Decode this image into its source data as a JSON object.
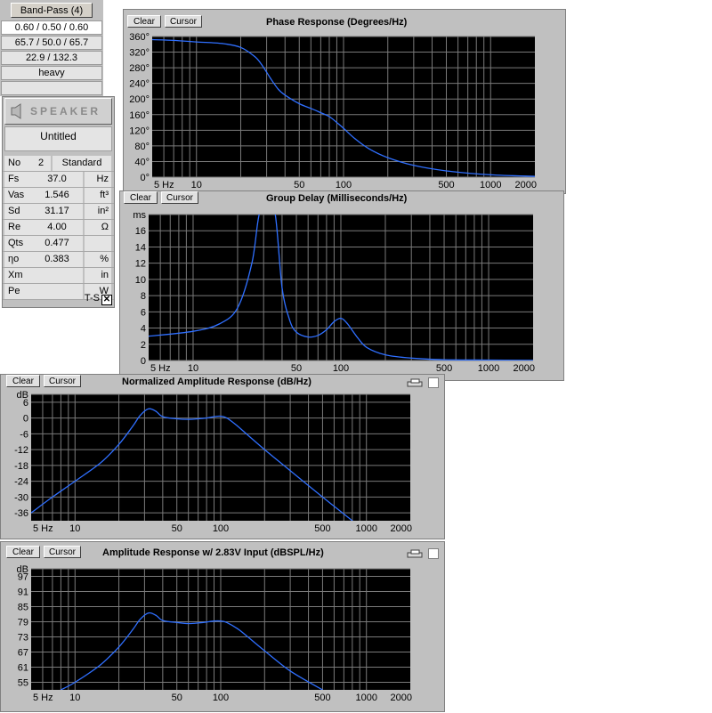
{
  "enclosure": {
    "type_button": "Band-Pass (4)",
    "rows": [
      "0.60 / 0.50 / 0.60",
      "65.7 / 50.0 / 65.7",
      "22.9 / 132.3",
      "heavy"
    ]
  },
  "speaker": {
    "header": "SPEAKER",
    "name": "Untitled",
    "no_label": "No",
    "no_value": "2",
    "no_mode": "Standard",
    "params": [
      {
        "label": "Fs",
        "value": "37.0",
        "unit": "Hz"
      },
      {
        "label": "Vas",
        "value": "1.546",
        "unit": "ft³"
      },
      {
        "label": "Sd",
        "value": "31.17",
        "unit": "in²"
      },
      {
        "label": "Re",
        "value": "4.00",
        "unit": "Ω"
      },
      {
        "label": "Qts",
        "value": "0.477",
        "unit": ""
      },
      {
        "label": "ηo",
        "value": "0.383",
        "unit": "%"
      },
      {
        "label": "Xm",
        "value": "",
        "unit": "in"
      },
      {
        "label": "Pe",
        "value": "",
        "unit": "W"
      }
    ],
    "ts_label": "T-S",
    "ts_checked": "✕"
  },
  "graphs": {
    "clear_label": "Clear",
    "cursor_label": "Cursor",
    "x_ticks": [
      5,
      10,
      50,
      100,
      500,
      1000,
      2000
    ],
    "x_tick_labels": [
      "5 Hz",
      "10",
      "50",
      "100",
      "500",
      "1000",
      "2000"
    ],
    "trace_color": "#2f6fff",
    "plot_bg": "#000000",
    "grid_color": "#7a7a7a"
  },
  "chart_data": [
    {
      "type": "line",
      "title": "Phase Response (Degrees/Hz)",
      "xscale": "log",
      "xlim": [
        5,
        2000
      ],
      "ylim": [
        0,
        360
      ],
      "ytick_labels": [
        "360°",
        "320°",
        "280°",
        "240°",
        "200°",
        "160°",
        "120°",
        "80°",
        "40°",
        "0°"
      ],
      "yticks": [
        360,
        320,
        280,
        240,
        200,
        160,
        120,
        80,
        40,
        0
      ],
      "x": [
        5,
        7,
        10,
        15,
        20,
        25,
        28,
        32,
        36,
        40,
        50,
        60,
        70,
        80,
        90,
        100,
        120,
        150,
        200,
        300,
        500,
        1000,
        2000
      ],
      "y": [
        352,
        350,
        346,
        342,
        332,
        308,
        286,
        252,
        225,
        210,
        188,
        176,
        165,
        155,
        140,
        125,
        98,
        72,
        50,
        30,
        16,
        6,
        2
      ]
    },
    {
      "type": "line",
      "title": "Group Delay (Milliseconds/Hz)",
      "xscale": "log",
      "xlim": [
        5,
        2000
      ],
      "ylim": [
        0,
        18
      ],
      "ytick_labels": [
        "ms",
        "16",
        "14",
        "12",
        "10",
        "8",
        "6",
        "4",
        "2",
        "0"
      ],
      "yticks": [
        18,
        16,
        14,
        12,
        10,
        8,
        6,
        4,
        2,
        0
      ],
      "x": [
        5,
        10,
        15,
        20,
        25,
        28,
        32,
        36,
        40,
        45,
        50,
        60,
        70,
        80,
        90,
        100,
        110,
        130,
        150,
        200,
        300,
        500,
        1000,
        2000
      ],
      "y": [
        3.0,
        3.6,
        4.5,
        6.5,
        12,
        18,
        20,
        18,
        9,
        5,
        3.5,
        2.9,
        3.1,
        3.8,
        4.8,
        5.2,
        4.6,
        2.8,
        1.6,
        0.7,
        0.3,
        0.1,
        0.05,
        0.02
      ]
    },
    {
      "type": "line",
      "title": "Normalized Amplitude Response (dB/Hz)",
      "xscale": "log",
      "xlim": [
        5,
        2000
      ],
      "ylim": [
        -39,
        9
      ],
      "ytick_labels": [
        "dB",
        "6",
        "0",
        "-6",
        "-12",
        "-18",
        "-24",
        "-30",
        "-36"
      ],
      "yticks": [
        9,
        6,
        0,
        -6,
        -12,
        -18,
        -24,
        -30,
        -36
      ],
      "x": [
        5,
        7,
        10,
        15,
        20,
        25,
        28,
        32,
        36,
        40,
        50,
        60,
        70,
        80,
        90,
        100,
        110,
        130,
        150,
        200,
        300,
        500,
        800
      ],
      "y": [
        -36,
        -30,
        -24,
        -17,
        -10,
        -3,
        1,
        3.5,
        2.5,
        0.5,
        -0.3,
        -0.5,
        -0.3,
        0,
        0.5,
        0.7,
        0,
        -3,
        -6,
        -12,
        -20,
        -30,
        -39
      ]
    },
    {
      "type": "line",
      "title": "Amplitude Response w/ 2.83V Input (dBSPL/Hz)",
      "xscale": "log",
      "xlim": [
        5,
        2000
      ],
      "ylim": [
        52,
        100
      ],
      "ytick_labels": [
        "dB",
        "97",
        "91",
        "85",
        "79",
        "73",
        "67",
        "61",
        "55"
      ],
      "yticks": [
        100,
        97,
        91,
        85,
        79,
        73,
        67,
        61,
        55
      ],
      "x": [
        8,
        10,
        15,
        20,
        25,
        28,
        32,
        36,
        40,
        50,
        60,
        70,
        80,
        90,
        100,
        110,
        130,
        150,
        200,
        300,
        500
      ],
      "y": [
        52,
        55,
        62,
        69,
        76,
        80,
        82.5,
        81.5,
        79.5,
        78.7,
        78.3,
        78.5,
        78.9,
        79.3,
        79.3,
        78.7,
        76.3,
        73.5,
        67.5,
        59.5,
        52
      ]
    }
  ]
}
